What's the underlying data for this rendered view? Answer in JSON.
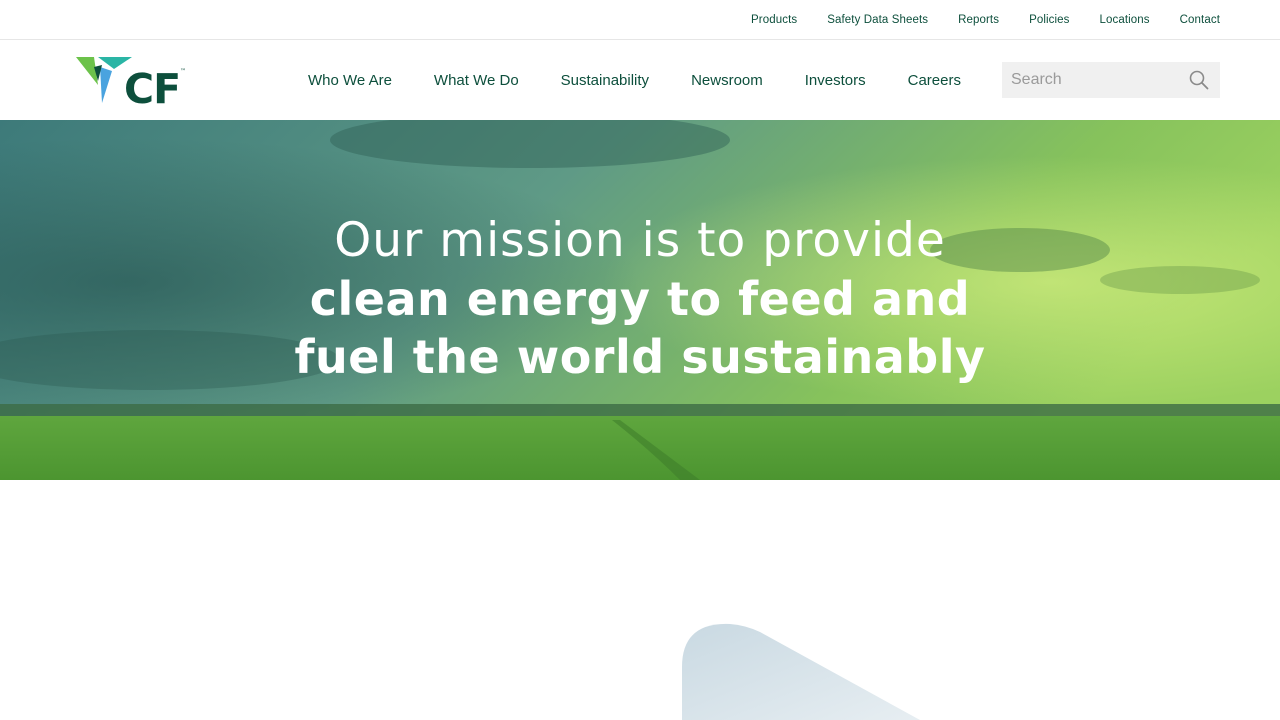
{
  "utility_nav": {
    "items": [
      {
        "label": "Products"
      },
      {
        "label": "Safety Data Sheets"
      },
      {
        "label": "Reports"
      },
      {
        "label": "Policies"
      },
      {
        "label": "Locations"
      },
      {
        "label": "Contact"
      }
    ]
  },
  "brand": {
    "logo_text": "CF",
    "trademark": "™",
    "colors": {
      "dark_green": "#0d4f3c",
      "light_green": "#6cc24a",
      "teal": "#2ab5a5",
      "blue": "#4aa3df"
    }
  },
  "main_nav": {
    "items": [
      {
        "label": "Who We Are"
      },
      {
        "label": "What We Do"
      },
      {
        "label": "Sustainability"
      },
      {
        "label": "Newsroom"
      },
      {
        "label": "Investors"
      },
      {
        "label": "Careers"
      }
    ]
  },
  "search": {
    "placeholder": "Search",
    "value": ""
  },
  "hero": {
    "line1": "Our mission is to provide",
    "line2": "clean energy to feed and",
    "line3": "fuel the world sustainably"
  }
}
